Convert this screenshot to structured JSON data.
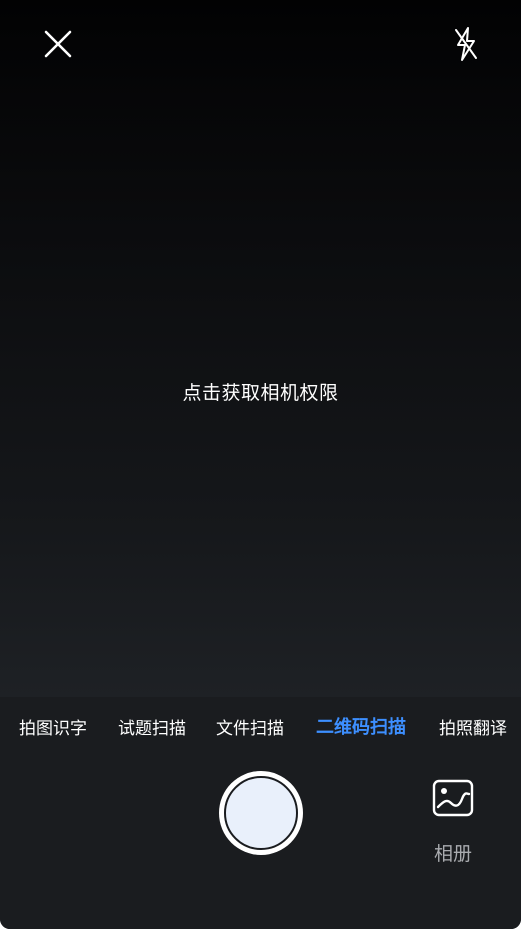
{
  "camera": {
    "permission_prompt": "点击获取相机权限"
  },
  "top_bar": {
    "close_icon": "close-icon",
    "flash_icon": "flash-off-icon"
  },
  "modes": [
    {
      "label": "拍图识字",
      "active": false
    },
    {
      "label": "试题扫描",
      "active": false
    },
    {
      "label": "文件扫描",
      "active": false
    },
    {
      "label": "二维码扫描",
      "active": true
    },
    {
      "label": "拍照翻译",
      "active": false
    }
  ],
  "bottom": {
    "album_label": "相册",
    "album_icon": "image-gallery-icon",
    "shutter_icon": "shutter-button"
  },
  "colors": {
    "active_mode": "#3d8fff",
    "panel_background": "#1a1c1f",
    "shutter_inner": "#e9f0fb"
  }
}
